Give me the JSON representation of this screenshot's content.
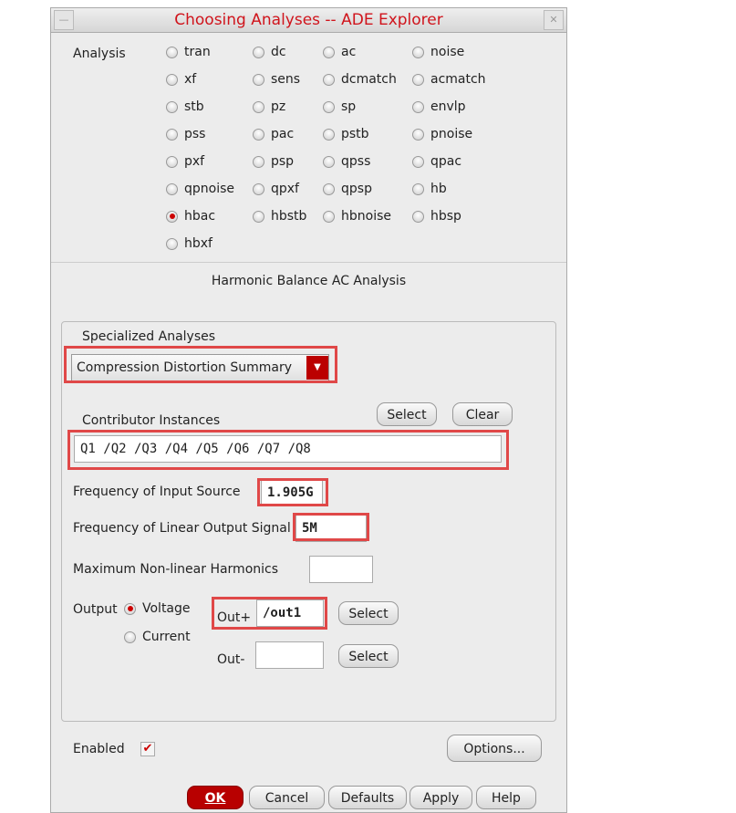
{
  "window": {
    "title": "Choosing Analyses -- ADE Explorer"
  },
  "analysis": {
    "label": "Analysis",
    "options": [
      "tran",
      "dc",
      "ac",
      "noise",
      "xf",
      "sens",
      "dcmatch",
      "acmatch",
      "stb",
      "pz",
      "sp",
      "envlp",
      "pss",
      "pac",
      "pstb",
      "pnoise",
      "pxf",
      "psp",
      "qpss",
      "qpac",
      "qpnoise",
      "qpxf",
      "qpsp",
      "hb",
      "hbac",
      "hbstb",
      "hbnoise",
      "hbsp",
      "hbxf"
    ],
    "selected": "hbac"
  },
  "section_title": "Harmonic Balance AC Analysis",
  "specialized": {
    "label": "Specialized Analyses",
    "value": "Compression Distortion Summary"
  },
  "contributors": {
    "label": "Contributor Instances",
    "select": "Select",
    "clear": "Clear",
    "value": "Q1 /Q2 /Q3 /Q4 /Q5 /Q6 /Q7 /Q8"
  },
  "freq_input": {
    "label": "Frequency of Input Source",
    "value": "1.905G"
  },
  "freq_linear": {
    "label": "Frequency of Linear Output Signal",
    "value": "5M"
  },
  "max_harm": {
    "label": "Maximum Non-linear Harmonics",
    "value": ""
  },
  "output": {
    "label": "Output",
    "voltage": "Voltage",
    "current": "Current",
    "selected": "Voltage",
    "outp_label": "Out+",
    "outp_value": "/out1",
    "outn_label": "Out-",
    "outn_value": "",
    "select": "Select"
  },
  "enabled": {
    "label": "Enabled",
    "checked": true
  },
  "buttons": {
    "options": "Options...",
    "ok": "OK",
    "cancel": "Cancel",
    "defaults": "Defaults",
    "apply": "Apply",
    "help": "Help"
  },
  "colors": {
    "accent": "#c00000",
    "highlight": "#e04848"
  }
}
